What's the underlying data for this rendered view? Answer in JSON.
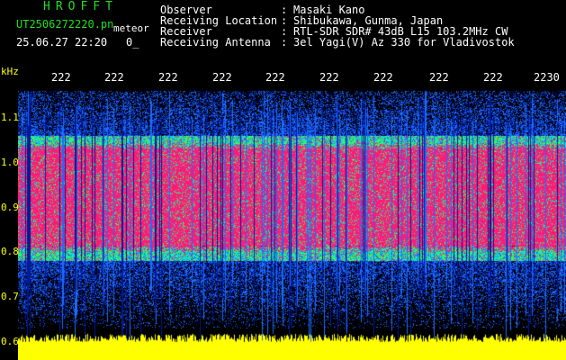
{
  "header": {
    "brand": "HROFFT",
    "filename": "UT2506272220.pn",
    "mode": "meteor",
    "datetime": "25.06.27 22:20",
    "counter": "0_",
    "fields": [
      {
        "label": "Observer",
        "sep": ":",
        "value": "Masaki Kano"
      },
      {
        "label": "Receiving Location",
        "sep": ":",
        "value": "Shibukawa, Gunma, Japan"
      },
      {
        "label": "Receiver",
        "sep": ":",
        "value": "RTL-SDR SDR# 43dB L15 103.2MHz CW"
      },
      {
        "label": "Receiving Antenna",
        "sep": ":",
        "value": "3el Yagi(V) Az 330 for Vladivostok"
      }
    ]
  },
  "axis": {
    "unit": "kHz",
    "y_ticks": [
      "1.1",
      "1.0",
      "0.9",
      "0.8",
      "0.7",
      "0.6"
    ],
    "time_ticks": [
      "222",
      "222",
      "222",
      "222",
      "222",
      "222",
      "222",
      "222",
      "222",
      "2230"
    ]
  },
  "spectrogram": {
    "colors": {
      "background": "#000000",
      "noise_low": "#001a99",
      "noise_high": "#1d6bff",
      "signal_edge": "#00e0e0",
      "signal_mid": "#40ff40",
      "signal_band": "#ff1a7a",
      "baseline": "#ffff00",
      "text_green": "#21e01d"
    }
  }
}
